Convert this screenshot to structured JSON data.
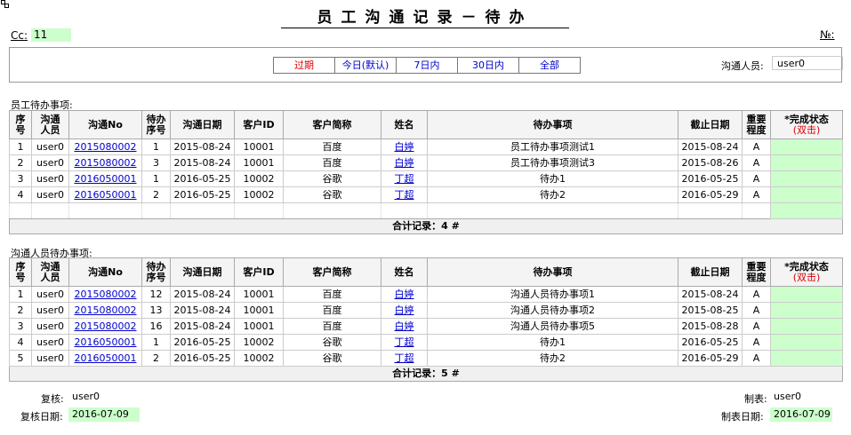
{
  "header": {
    "title": "员工沟通记录－待办",
    "cc_label": "Cc:",
    "cc_value": "11",
    "no_label": "№:"
  },
  "filters": {
    "buttons": [
      {
        "label": "过期",
        "color": "#dd0000"
      },
      {
        "label": "今日(默认)",
        "color": "#0000cc"
      },
      {
        "label": "7日内",
        "color": "#0000cc"
      },
      {
        "label": "30日内",
        "color": "#0000cc"
      },
      {
        "label": "全部",
        "color": "#0000cc"
      }
    ],
    "comm_person_label": "沟通人员:",
    "comm_person_value": "user0"
  },
  "columns": {
    "seq": [
      "序",
      "号"
    ],
    "person": [
      "沟通",
      "人员"
    ],
    "comm_no": "沟通No",
    "todo_seq": [
      "待办",
      "序号"
    ],
    "comm_date": "沟通日期",
    "cust_id": "客户ID",
    "cust_short": "客户简称",
    "name": "姓名",
    "item": "待办事项",
    "deadline": "截止日期",
    "importance": [
      "重要",
      "程度"
    ],
    "status": "*完成状态",
    "status_hint": "(双击)"
  },
  "employee_section": {
    "label": "员工待办事项:",
    "rows": [
      [
        "1",
        "user0",
        "2015080002",
        "1",
        "2015-08-24",
        "10001",
        "百度",
        "白婷",
        "员工待办事项测试1",
        "2015-08-24",
        "A"
      ],
      [
        "2",
        "user0",
        "2015080002",
        "3",
        "2015-08-24",
        "10001",
        "百度",
        "白婷",
        "员工待办事项测试3",
        "2015-08-26",
        "A"
      ],
      [
        "3",
        "user0",
        "2016050001",
        "1",
        "2016-05-25",
        "10002",
        "谷歌",
        "丁超",
        "待办1",
        "2016-05-25",
        "A"
      ],
      [
        "4",
        "user0",
        "2016050001",
        "2",
        "2016-05-25",
        "10002",
        "谷歌",
        "丁超",
        "待办2",
        "2016-05-29",
        "A"
      ]
    ],
    "total": "合计记录：4 #"
  },
  "comm_section": {
    "label": "沟通人员待办事项:",
    "rows": [
      [
        "1",
        "user0",
        "2015080002",
        "12",
        "2015-08-24",
        "10001",
        "百度",
        "白婷",
        "沟通人员待办事项1",
        "2015-08-24",
        "A"
      ],
      [
        "2",
        "user0",
        "2015080002",
        "13",
        "2015-08-24",
        "10001",
        "百度",
        "白婷",
        "沟通人员待办事项2",
        "2015-08-25",
        "A"
      ],
      [
        "3",
        "user0",
        "2015080002",
        "16",
        "2015-08-24",
        "10001",
        "百度",
        "白婷",
        "沟通人员待办事项5",
        "2015-08-28",
        "A"
      ],
      [
        "4",
        "user0",
        "2016050001",
        "1",
        "2016-05-25",
        "10002",
        "谷歌",
        "丁超",
        "待办1",
        "2016-05-25",
        "A"
      ],
      [
        "5",
        "user0",
        "2016050001",
        "2",
        "2016-05-25",
        "10002",
        "谷歌",
        "丁超",
        "待办2",
        "2016-05-29",
        "A"
      ]
    ],
    "total": "合计记录：5 #"
  },
  "footer": {
    "reviewer_label": "复核:",
    "reviewer_value": "user0",
    "review_date_label": "复核日期:",
    "review_date_value": "2016-07-09",
    "maker_label": "制表:",
    "maker_value": "user0",
    "make_date_label": "制表日期:",
    "make_date_value": "2016-07-09"
  },
  "colors": {
    "status_green": "#ccffcc",
    "link": "#0000cc",
    "alert": "#dd0000"
  }
}
